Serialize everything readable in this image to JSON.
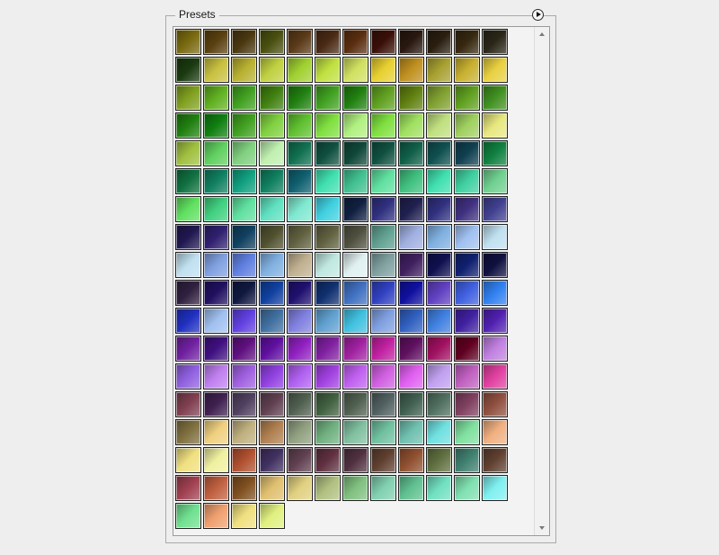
{
  "panel": {
    "title": "Presets",
    "menu_icon": "arrow-right-circle-icon",
    "scroll_up_icon": "chevron-up-icon",
    "scroll_down_icon": "chevron-down-icon"
  },
  "rows": [
    [
      "#7a6a10",
      "#5a4010",
      "#4a3810",
      "#4a5010",
      "#5a3a18",
      "#4a2a14",
      "#5a2e10",
      "#3a1008",
      "#281810",
      "#2a1e10",
      "#362810",
      "#2a2618"
    ],
    [
      "#1a3a10",
      "#c8c040",
      "#b8b030",
      "#c0d040",
      "#a0d030",
      "#c0e040",
      "#d0e060",
      "#e8d030",
      "#c09020",
      "#a8a030",
      "#c8b030",
      "#e8d040"
    ],
    [
      "#80a020",
      "#60b020",
      "#40a020",
      "#408010",
      "#208010",
      "#40a020",
      "#208010",
      "#60a020",
      "#608010",
      "#80a030",
      "#60a020",
      "#409020"
    ],
    [
      "#208010",
      "#108010",
      "#40a020",
      "#80d040",
      "#60c030",
      "#80e040",
      "#b0f080",
      "#80e040",
      "#a0e060",
      "#c0e080",
      "#a0d060",
      "#e8e880"
    ],
    [
      "#a0c040",
      "#60d060",
      "#80d080",
      "#c0f0b0",
      "#107050",
      "#105040",
      "#104838",
      "#105040",
      "#106048",
      "#105050",
      "#104050",
      "#108040"
    ],
    [
      "#107040",
      "#108060",
      "#10a080",
      "#108060",
      "#106070",
      "#40e0b0",
      "#40c090",
      "#60e0a0",
      "#40c080",
      "#40e0b0",
      "#40d0a0",
      "#70d090"
    ],
    [
      "#60e060",
      "#40d080",
      "#60e0a0",
      "#60e0c0",
      "#80e8d0",
      "#40d0e0",
      "#102040",
      "#303080",
      "#202050",
      "#303080",
      "#403080",
      "#404090"
    ],
    [
      "#201850",
      "#302070",
      "#104060",
      "#505030",
      "#606040",
      "#606040",
      "#505040",
      "#60a090",
      "#a0b0e0",
      "#80b0e0",
      "#a0c0f0",
      "#c0e0f0"
    ],
    [
      "#c0e0f0",
      "#80a0e0",
      "#6080e0",
      "#80b0e0",
      "#c0b090",
      "#c0e8e0",
      "#e0f0f0",
      "#80a0a0",
      "#402060",
      "#101050",
      "#102070",
      "#101040"
    ],
    [
      "#302040",
      "#201060",
      "#101840",
      "#1040a0",
      "#201070",
      "#103070",
      "#4070c0",
      "#3040c0",
      "#1010a0",
      "#6040c0",
      "#4060e0",
      "#3080f0"
    ],
    [
      "#2030c0",
      "#a0c0f0",
      "#6040e0",
      "#4070a0",
      "#8080e0",
      "#60a0d0",
      "#40c0e0",
      "#80a0e0",
      "#3060c0",
      "#4080e0",
      "#4020a0",
      "#5020b0"
    ],
    [
      "#7020a0",
      "#401080",
      "#601080",
      "#6010a0",
      "#9020c0",
      "#8020a0",
      "#a020a0",
      "#c020a0",
      "#601060",
      "#a01060",
      "#600020",
      "#c080e0"
    ],
    [
      "#9060e0",
      "#c080f0",
      "#a060e0",
      "#9040e0",
      "#b060f0",
      "#a040e0",
      "#c060f0",
      "#d060e0",
      "#e060f0",
      "#c0a0f0",
      "#c060c0",
      "#e040a0"
    ],
    [
      "#804050",
      "#402050",
      "#504060",
      "#604050",
      "#506050",
      "#406040",
      "#506050",
      "#506060",
      "#406050",
      "#507060",
      "#804060",
      "#905040"
    ],
    [
      "#807040",
      "#f0d080",
      "#c0b080",
      "#b08050",
      "#90a080",
      "#70b080",
      "#80c0a0",
      "#70c0a0",
      "#70c0b0",
      "#70e0e0",
      "#80e0a0",
      "#f0b080"
    ],
    [
      "#f0e080",
      "#f0f0a0",
      "#b05030",
      "#403060",
      "#604050",
      "#603040",
      "#503040",
      "#604030",
      "#905030",
      "#607040",
      "#408070",
      "#604030"
    ],
    [
      "#a04050",
      "#c06040",
      "#805020",
      "#e0c070",
      "#e0d080",
      "#b0c080",
      "#80c080",
      "#80d0b0",
      "#60c090",
      "#70e0c0",
      "#80e0b0",
      "#80f0f0"
    ],
    [
      "#70e090",
      "#f0a070",
      "#f0e080",
      "#e0f080"
    ]
  ]
}
